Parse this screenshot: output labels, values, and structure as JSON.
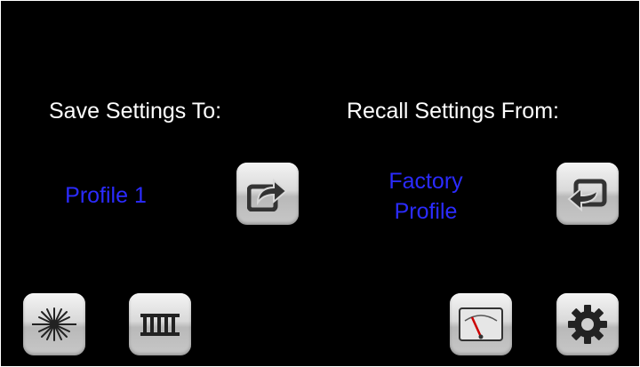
{
  "save": {
    "heading": "Save Settings To:",
    "profile": "Profile 1",
    "button_icon": "export-arrow-icon"
  },
  "recall": {
    "heading": "Recall Settings From:",
    "profile_line1": "Factory",
    "profile_line2": "Profile",
    "button_icon": "import-arrow-icon"
  },
  "bottom_bar": {
    "icons": [
      "laser-burst-icon",
      "comb-filter-icon",
      "meter-gauge-icon",
      "gear-icon"
    ]
  },
  "colors": {
    "background": "#000000",
    "heading_text": "#ffffff",
    "profile_text": "#2b2bff",
    "button_face": "#d9d9d9",
    "icon_dark": "#333333",
    "needle_red": "#cc0000"
  }
}
